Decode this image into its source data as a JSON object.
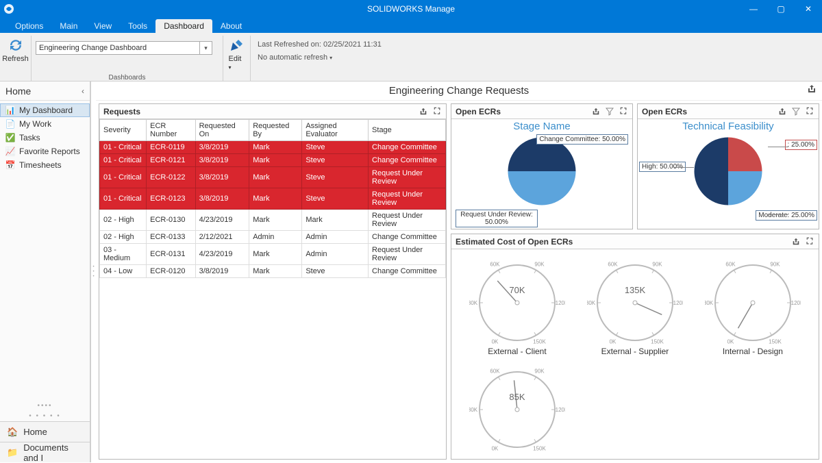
{
  "app": {
    "title": "SOLIDWORKS Manage"
  },
  "menu": {
    "items": [
      "Options",
      "Main",
      "View",
      "Tools",
      "Dashboard",
      "About"
    ],
    "active": "Dashboard"
  },
  "ribbon": {
    "refresh": "Refresh",
    "dashboard_selector": "Engineering Change Dashboard",
    "edit": "Edit",
    "last_refreshed": "Last Refreshed on: 02/25/2021 11:31",
    "auto_refresh": "No automatic refresh",
    "group_caption": "Dashboards"
  },
  "sidebar": {
    "header": "Home",
    "items": [
      {
        "label": "My Dashboard",
        "icon": "📊",
        "selected": true
      },
      {
        "label": "My Work",
        "icon": "📄",
        "selected": false
      },
      {
        "label": "Tasks",
        "icon": "✅",
        "selected": false
      },
      {
        "label": "Favorite Reports",
        "icon": "📈",
        "selected": false
      },
      {
        "label": "Timesheets",
        "icon": "📅",
        "selected": false
      }
    ],
    "bottom": [
      {
        "label": "Home",
        "icon": "🏠"
      },
      {
        "label": "Documents and I",
        "icon": "📁"
      }
    ]
  },
  "content": {
    "title": "Engineering Change Requests"
  },
  "requests": {
    "title": "Requests",
    "columns": [
      "Severity",
      "ECR Number",
      "Requested On",
      "Requested By",
      "Assigned Evaluator",
      "Stage"
    ],
    "rows": [
      {
        "cells": [
          "01 - Critical",
          "ECR-0119",
          "3/8/2019",
          "Mark",
          "Steve",
          "Change Committee"
        ],
        "critical": true
      },
      {
        "cells": [
          "01 - Critical",
          "ECR-0121",
          "3/8/2019",
          "Mark",
          "Steve",
          "Change Committee"
        ],
        "critical": true
      },
      {
        "cells": [
          "01 - Critical",
          "ECR-0122",
          "3/8/2019",
          "Mark",
          "Steve",
          "Request Under Review"
        ],
        "critical": true
      },
      {
        "cells": [
          "01 - Critical",
          "ECR-0123",
          "3/8/2019",
          "Mark",
          "Steve",
          "Request Under Review"
        ],
        "critical": true
      },
      {
        "cells": [
          "02 - High",
          "ECR-0130",
          "4/23/2019",
          "Mark",
          "Mark",
          "Request Under Review"
        ],
        "critical": false
      },
      {
        "cells": [
          "02 - High",
          "ECR-0133",
          "2/12/2021",
          "Admin",
          "Admin",
          "Change Committee"
        ],
        "critical": false
      },
      {
        "cells": [
          "03 - Medium",
          "ECR-0131",
          "4/23/2019",
          "Mark",
          "Admin",
          "Request Under Review"
        ],
        "critical": false
      },
      {
        "cells": [
          "04 - Low",
          "ECR-0120",
          "3/8/2019",
          "Mark",
          "Steve",
          "Change Committee"
        ],
        "critical": false
      }
    ]
  },
  "pie1": {
    "panel_title": "Open ECRs",
    "chart_title": "Stage Name",
    "callout_top": "Change Committee: 50.00%",
    "callout_bottom": "Request Under Review: 50.00%"
  },
  "pie2": {
    "panel_title": "Open ECRs",
    "chart_title": "Technical Feasibility",
    "callout_left": "High: 50.00%",
    "callout_right_top": ": 25.00%",
    "callout_right_bottom": "Moderate: 25.00%"
  },
  "gauges": {
    "panel_title": "Estimated Cost of Open ECRs",
    "ticks": [
      "0K",
      "30K",
      "60K",
      "90K",
      "120K",
      "150K"
    ],
    "items": [
      {
        "label": "External - Client",
        "value": "70K",
        "angle": -42
      },
      {
        "label": "External - Supplier",
        "value": "135K",
        "angle": 114
      },
      {
        "label": "Internal - Design",
        "value": "",
        "angle": -150
      },
      {
        "label": "",
        "value": "85K",
        "angle": -6
      }
    ]
  },
  "chart_data": [
    {
      "type": "pie",
      "title": "Stage Name",
      "series": [
        {
          "name": "Change Committee",
          "value": 50.0
        },
        {
          "name": "Request Under Review",
          "value": 50.0
        }
      ]
    },
    {
      "type": "pie",
      "title": "Technical Feasibility",
      "series": [
        {
          "name": "High",
          "value": 50.0
        },
        {
          "name": "(blank)",
          "value": 25.0
        },
        {
          "name": "Moderate",
          "value": 25.0
        }
      ]
    },
    {
      "type": "gauge",
      "title": "Estimated Cost of Open ECRs",
      "range": [
        0,
        150
      ],
      "unit": "K",
      "items": [
        {
          "name": "External - Client",
          "value": 70
        },
        {
          "name": "External - Supplier",
          "value": 135
        },
        {
          "name": "Internal - Design",
          "value": 0
        },
        {
          "name": "",
          "value": 85
        }
      ]
    }
  ],
  "colors": {
    "brand": "#0078d7",
    "critical": "#d9262e",
    "pie_light": "#5ca4dc",
    "pie_dark": "#1c3b68",
    "pie_red": "#c94a4a"
  }
}
